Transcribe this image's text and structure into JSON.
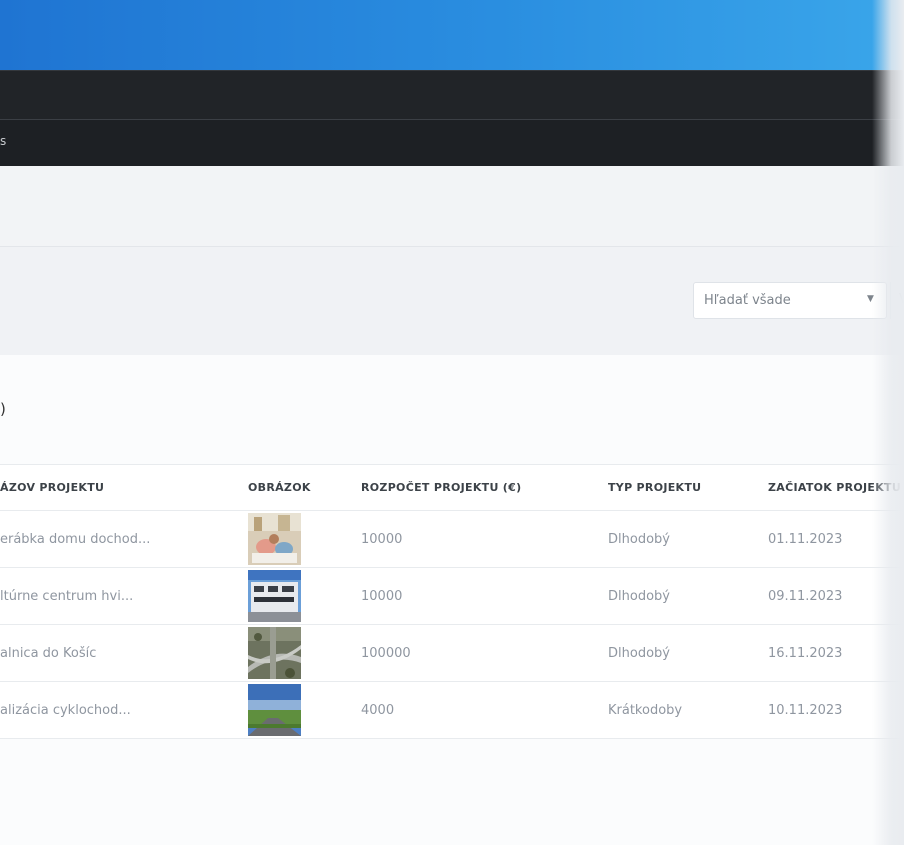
{
  "nav": {
    "fragment": "s"
  },
  "search": {
    "select_value": "Hľadať všade",
    "next_fragment": "V"
  },
  "section": {
    "count_fragment": ")"
  },
  "table": {
    "headers": [
      "ÁZOV PROJEKTU",
      "OBRÁZOK",
      "ROZPOČET PROJEKTU (€)",
      "TYP PROJEKTU",
      "ZAČIATOK PROJEKTU"
    ],
    "rows": [
      {
        "name": "erábka domu dochod...",
        "image": "elderly-home-thumbnail",
        "budget": "10000",
        "type": "Dlhodobý",
        "start": "01.11.2023"
      },
      {
        "name": "ltúrne centrum hvi...",
        "image": "culture-center-thumbnail",
        "budget": "10000",
        "type": "Dlhodobý",
        "start": "09.11.2023"
      },
      {
        "name": "alnica do Košíc",
        "image": "highway-thumbnail",
        "budget": "100000",
        "type": "Dlhodobý",
        "start": "16.11.2023"
      },
      {
        "name": "alizácia cyklochod...",
        "image": "cycle-path-thumbnail",
        "budget": "4000",
        "type": "Krátkodoby",
        "start": "10.11.2023"
      }
    ]
  },
  "colors": {
    "banner": "#2a8ee0",
    "navbar": "#212428",
    "link_text": "#8f96a0"
  }
}
